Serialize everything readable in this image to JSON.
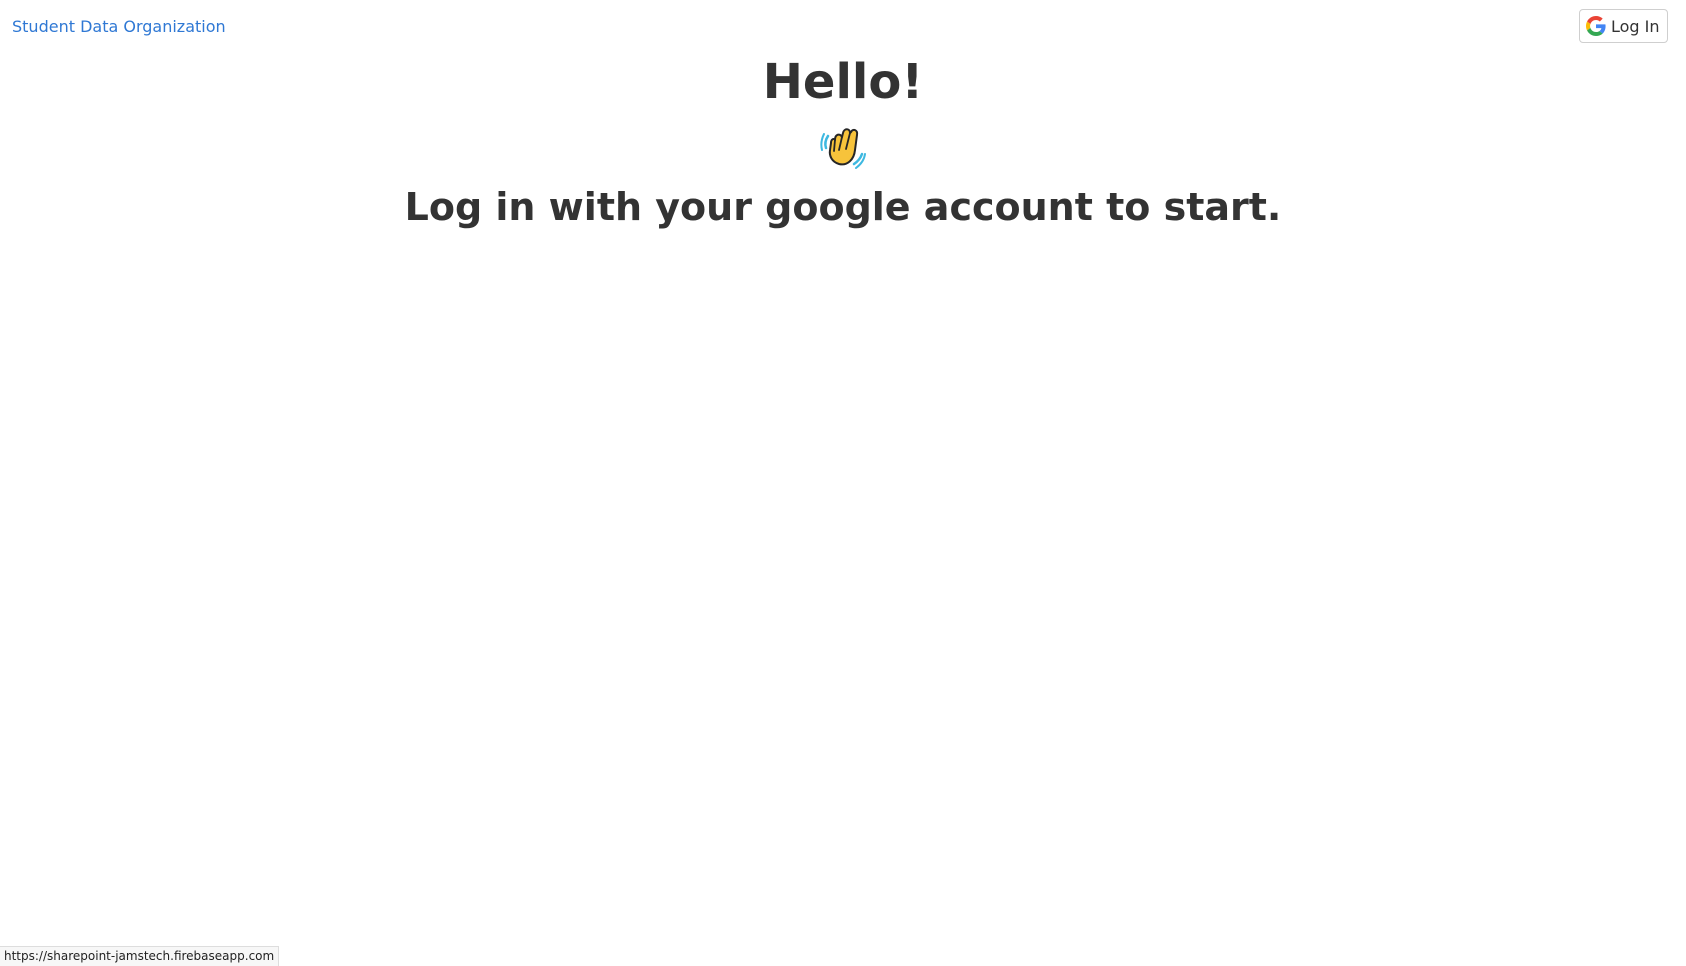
{
  "navbar": {
    "brand": "Student Data Organization",
    "login_label": "Log In",
    "login_icon": "google-g-icon"
  },
  "main": {
    "title": "Hello!",
    "emoji_icon": "waving-hand-icon",
    "subtitle": "Log in with your google account to start."
  },
  "status_bar": {
    "url": "https://sharepoint-jamstech.firebaseapp.com"
  },
  "colors": {
    "brand_link": "#2f78d4",
    "text": "#333333",
    "background": "#ffffff"
  }
}
